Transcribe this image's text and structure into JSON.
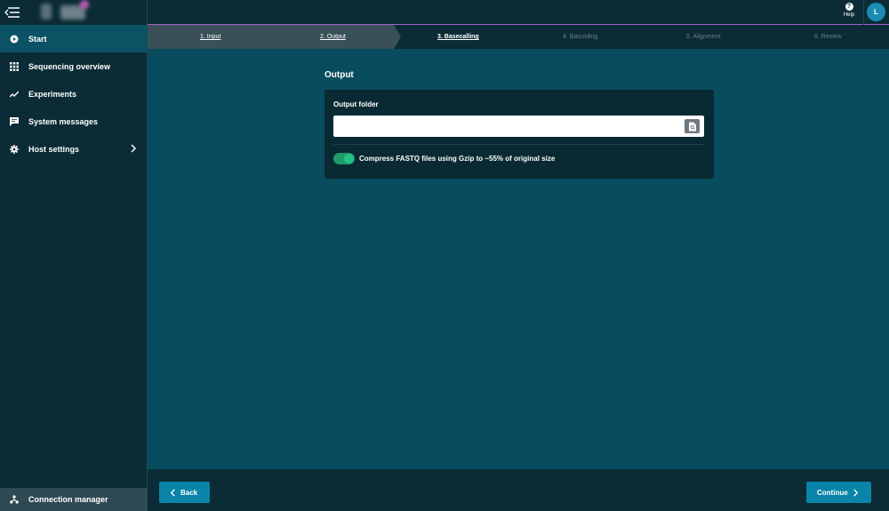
{
  "nav": {
    "items": [
      {
        "label": "Start",
        "icon": "play-circle-icon"
      },
      {
        "label": "Sequencing overview",
        "icon": "grid-icon"
      },
      {
        "label": "Experiments",
        "icon": "trend-icon"
      },
      {
        "label": "System messages",
        "icon": "message-icon"
      },
      {
        "label": "Host settings",
        "icon": "gear-icon"
      }
    ],
    "connection_manager": "Connection manager"
  },
  "topbar": {
    "help_label": "Help",
    "help_icon": "?",
    "avatar_initial": "L"
  },
  "stepper": {
    "steps": [
      {
        "label": "1. Input",
        "state": "done"
      },
      {
        "label": "2. Output",
        "state": "done"
      },
      {
        "label": "3. Basecalling",
        "state": "current"
      },
      {
        "label": "4. Barcoding",
        "state": "future"
      },
      {
        "label": "5. Alignment",
        "state": "future"
      },
      {
        "label": "6. Review",
        "state": "future"
      }
    ]
  },
  "main": {
    "section_title": "Output",
    "output_folder_label": "Output folder",
    "output_folder_value": "",
    "compress_toggle": {
      "label": "Compress FASTQ files using Gzip to ~55% of original size",
      "on": true
    }
  },
  "footer": {
    "back_label": "Back",
    "continue_label": "Continue"
  },
  "colors": {
    "main_bg": "#0a4c5f",
    "sidebar_bg": "#0b2c36",
    "accent": "#0a84a8",
    "toggle_on": "#26c281",
    "topbar_border": "#9f62c9"
  }
}
